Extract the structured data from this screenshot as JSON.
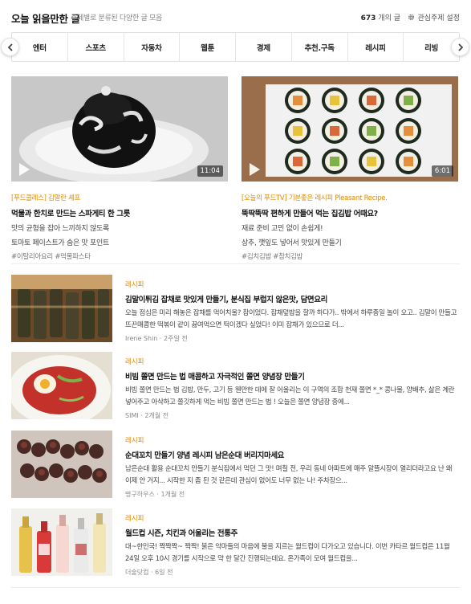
{
  "header": {
    "title": "오늘 읽을만한 글",
    "subtitle": "주제별로 분류된 다양한 글 모음",
    "count_number": "673",
    "count_suffix": "개의 글",
    "settings_label": "관심주제 설정"
  },
  "categories": [
    "엔터",
    "스포츠",
    "자동차",
    "웹툰",
    "경제",
    "추천.구독",
    "레시피",
    "리빙"
  ],
  "featured": [
    {
      "source": "[푸드클레스] 김말란 셰프",
      "title": "먹물과 한치로 만드는 스파게티 한 그릇",
      "line1": "맛의 균형을 잡아 느끼하지 않도록",
      "line2": "토마토 페이스트가 숨은 맛 포인트",
      "tags": "#이탈리아요리 #먹물파스타",
      "duration": "11:04"
    },
    {
      "source": "[오늘의 푸드TV] 기분좋은 레시피 Pleasant Recipe.",
      "title": "뚝딱뚝딱 편하게 만들어 먹는 집김밥 어때요?",
      "line1": "재료 준비 고민 없이 손쉽게!",
      "line2": "상추, 깻잎도 넣어서 맛있게 만들기",
      "tags": "#김치김밥 #참치김밥",
      "duration": "6:01"
    }
  ],
  "items": [
    {
      "category": "레시피",
      "title": "김말이튀김 잡채로 맛있게 만들기, 분식집 부럽지 않은맛, 담면요리",
      "snippet": "오늘 점심은 미리 해놓은 잡채를 먹어치울? 참이었다. 잡채덮밥을 할까 하다가.. 밖에서 하루종일 놀이 오고.. 김말이 만들고 뜨끈매콤한 떡볶이 같이 끓여먹으면 떡이겠다 싶었다! 이미 잡채가 있으므로 더...",
      "author": "Irene Shin",
      "time": "2주일 전"
    },
    {
      "category": "레시피",
      "title": "비빔 쫄면 만드는 법 매콤하고 자극적인 쫄면 양념장 만들기",
      "snippet": "비빔 쫄면 만드는 법 김밥, 만두, 고기 등 웬만한 데에 잘 어울리는 이 구역의 조합 천재 쫄면 *_* 콩나물, 양배추, 삶은 계란 넣어주고 아삭하고 쫄깃하게 먹는 비빔 쫄면 만드는 법 ! 오늘은 쫄면 양념장 중에...",
      "author": "SIMI",
      "time": "2개월 전"
    },
    {
      "category": "레시피",
      "title": "순대꼬치 만들기 양념 레시피 남은순대 버리지마세요",
      "snippet": "남은순대 활용 순대꼬치 만들기 분식집에서 먹던 그 맛! 며칠 전, 우리 동네 아파트에 매주 알뜰시장이 열리더라고요 난 왜 이제 안 거지... 시작한 지 좀 된 것 같은데 관심이 없어도 너무 없는 나! 주차장으...",
      "author": "명구하우스",
      "time": "1개월 전"
    },
    {
      "category": "레시피",
      "title": "월드컵 시즌, 치킨과 어울리는 전통주",
      "snippet": "대~한민국! 짝짝짝~ 짝짝! 붉은 악마들의 마음에 불을 지르는 월드컵이 다가오고 있습니다. 이번 카타르 월드컵은 11월 24일 오후 10시 경기를 시작으로 약 한 달간 진행되는데요. 온가족이 모여 월드컵을...",
      "author": "더술닷컴",
      "time": "6일 전"
    }
  ],
  "colors": {
    "accent": "#e08a00",
    "divider": "#ececec"
  },
  "icons": {
    "settings": "gear-icon",
    "prev": "chevron-left-icon",
    "next": "chevron-right-icon",
    "play": "play-icon"
  }
}
